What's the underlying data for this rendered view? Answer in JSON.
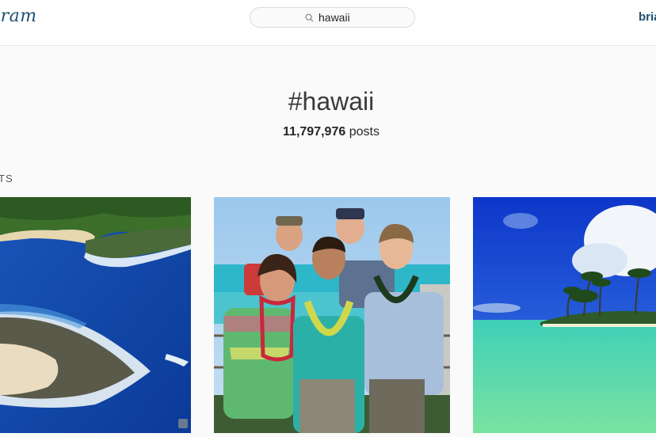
{
  "header": {
    "logo_text": "gram",
    "search_value": "hawaii",
    "user_text": "bria"
  },
  "hashtag": {
    "title": "#hawaii",
    "count": "11,797,976",
    "count_suffix": " posts"
  },
  "section_label": "TS",
  "posts": [
    {
      "subject": "aerial coastline with reef and surf"
    },
    {
      "subject": "family group photo with leis on balcony"
    },
    {
      "subject": "tropical beach with palm trees"
    }
  ],
  "colors": {
    "brand": "#1d4f72",
    "text": "#262626",
    "background": "#fafafa"
  }
}
